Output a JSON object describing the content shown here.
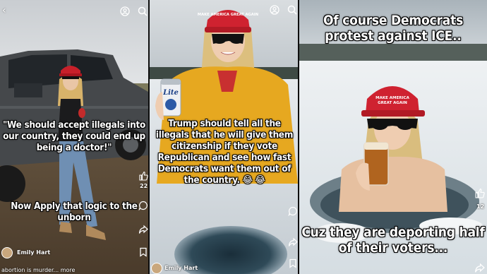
{
  "panels": [
    {
      "caption_top": "\"We should accept illegals into our country, they could end up being a doctor!\"",
      "caption_bottom": "Now Apply that logic to the unborn",
      "author": "Emily Hart",
      "description": "abortion is murder... more",
      "like_count": "22",
      "hat_text": "MAKE AMERICA GREAT AGAIN",
      "icons": {
        "back": "chevron-left-icon",
        "profile": "profile-icon",
        "search": "search-icon",
        "like": "thumbs-up-icon",
        "comment": "comment-icon",
        "share": "share-icon",
        "save": "bookmark-icon"
      }
    },
    {
      "caption": "Trump should tell all the illegals that he will give them citizenship if they vote Republican and see how fast Democrats want them out of the country. 😂 😂",
      "author": "Emily Hart",
      "hat_text": "MAKE AMERICA GREAT AGAIN",
      "can_text": "Lite",
      "icons": {
        "profile": "profile-icon",
        "search": "search-icon",
        "comment": "comment-icon",
        "share": "share-icon",
        "save": "bookmark-icon"
      }
    },
    {
      "caption_top": "Of course Democrats protest against ICE..",
      "caption_bottom": "Cuz they are deporting half of their voters...",
      "like_count": "12",
      "hat_text": "MAKE AMERICA GREAT AGAIN",
      "icons": {
        "like": "thumbs-up-icon",
        "share": "share-icon"
      }
    }
  ]
}
